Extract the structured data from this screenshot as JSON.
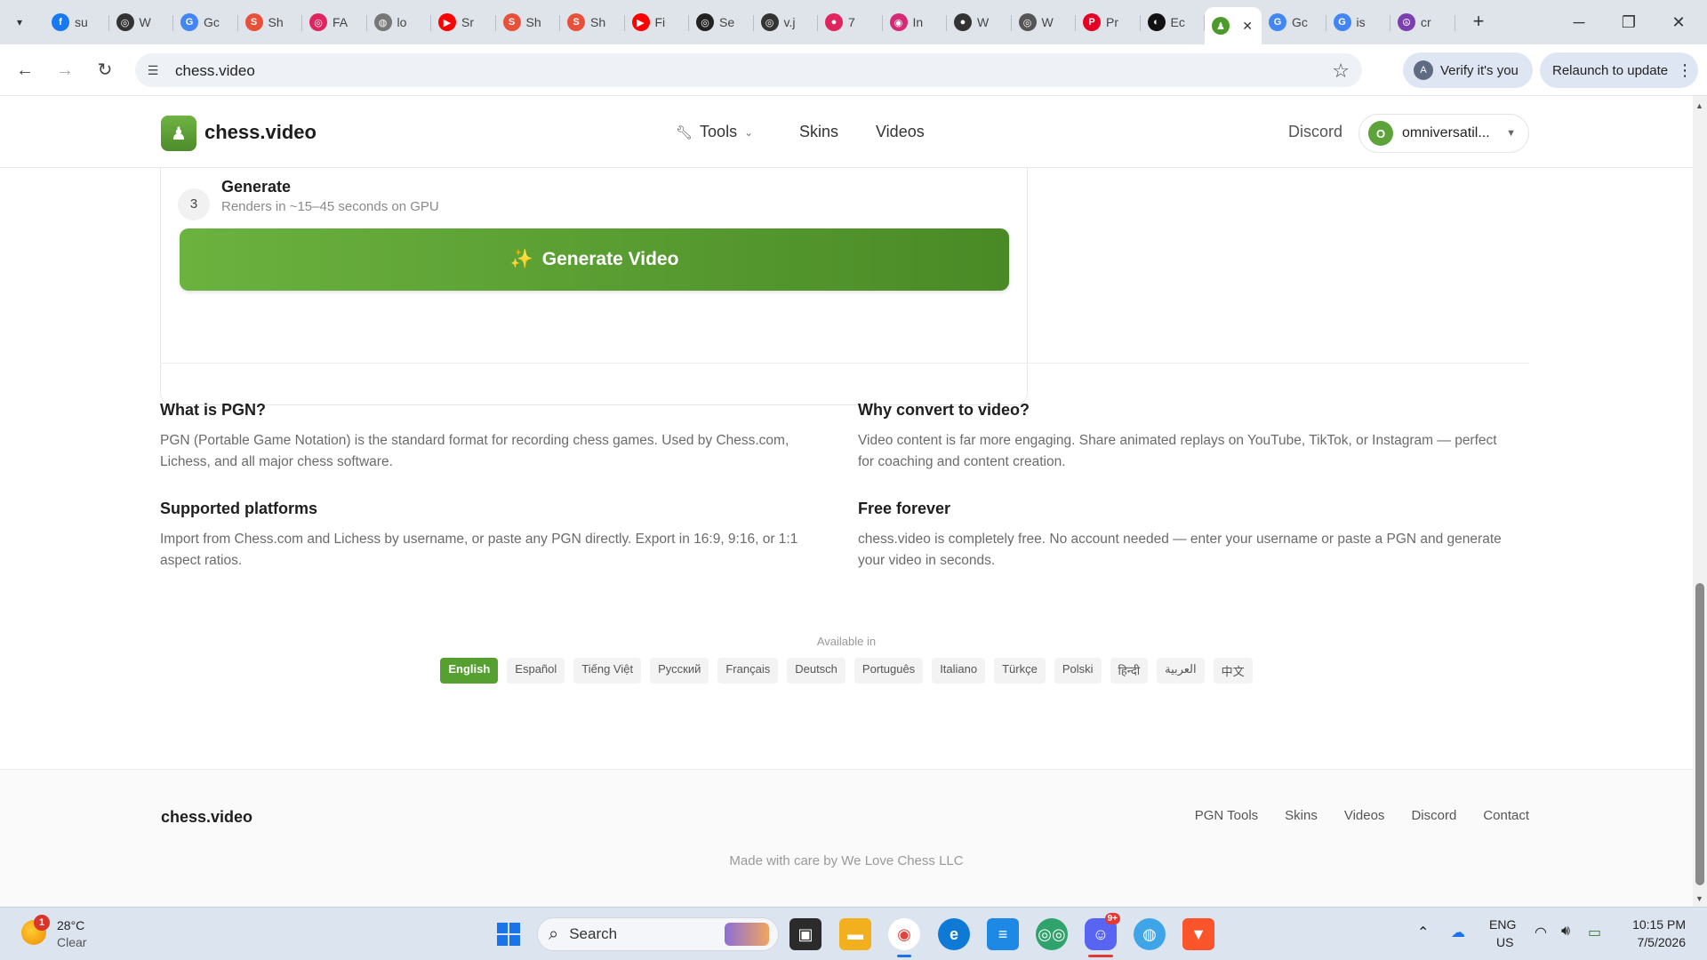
{
  "browser": {
    "tabs": [
      {
        "label": "su",
        "icon": "facebook-icon",
        "color": "#1877f2",
        "glyph": "f"
      },
      {
        "label": "W",
        "icon": "openai-icon",
        "color": "#333333",
        "glyph": "◎"
      },
      {
        "label": "Gc",
        "icon": "google-icon",
        "color": "#4285f4",
        "glyph": "G"
      },
      {
        "label": "Sh",
        "icon": "shopify-icon",
        "color": "#e8503a",
        "glyph": "S"
      },
      {
        "label": "FA",
        "icon": "target-icon",
        "color": "#e0245e",
        "glyph": "◎"
      },
      {
        "label": "lo",
        "icon": "globe-icon",
        "color": "#777777",
        "glyph": "◍"
      },
      {
        "label": "Sr",
        "icon": "youtube-icon",
        "color": "#ff0000",
        "glyph": "▶"
      },
      {
        "label": "Sh",
        "icon": "shopify-icon",
        "color": "#e8503a",
        "glyph": "S"
      },
      {
        "label": "Sh",
        "icon": "shopify-icon",
        "color": "#e8503a",
        "glyph": "S"
      },
      {
        "label": "Fi",
        "icon": "youtube-icon",
        "color": "#ff0000",
        "glyph": "▶"
      },
      {
        "label": "Se",
        "icon": "openai-icon",
        "color": "#222222",
        "glyph": "◎"
      },
      {
        "label": "v.j",
        "icon": "openai-icon",
        "color": "#333333",
        "glyph": "◎"
      },
      {
        "label": "7",
        "icon": "record-icon",
        "color": "#e0245e",
        "glyph": "●"
      },
      {
        "label": "In",
        "icon": "instagram-icon",
        "color": "#d62976",
        "glyph": "◉"
      },
      {
        "label": "W",
        "icon": "movie-icon",
        "color": "#333333",
        "glyph": "●"
      },
      {
        "label": "W",
        "icon": "openai-icon",
        "color": "#555555",
        "glyph": "◎"
      },
      {
        "label": "Pr",
        "icon": "pinterest-icon",
        "color": "#e60023",
        "glyph": "P"
      },
      {
        "label": "Ec",
        "icon": "github-icon",
        "color": "#111111",
        "glyph": "◐"
      },
      {
        "label": "",
        "icon": "chess-video-icon",
        "color": "#4c9a2a",
        "glyph": "♟",
        "active": true
      },
      {
        "label": "Gc",
        "icon": "google-icon",
        "color": "#4285f4",
        "glyph": "G"
      },
      {
        "label": "is",
        "icon": "google-icon",
        "color": "#4285f4",
        "glyph": "G"
      },
      {
        "label": "cr",
        "icon": "peace-icon",
        "color": "#7b3fb0",
        "glyph": "☮"
      }
    ],
    "url": "chess.video",
    "verify_label": "Verify it's you",
    "verify_avatar": "A",
    "relaunch_label": "Relaunch to update"
  },
  "site": {
    "logo_text": "chess.video",
    "nav": {
      "tools": "Tools",
      "skins": "Skins",
      "videos": "Videos",
      "discord": "Discord"
    },
    "user": {
      "initial": "O",
      "name": "omniversatil..."
    }
  },
  "generate": {
    "step_number": "3",
    "step_title": "Generate",
    "step_subtitle": "Renders in ~15–45 seconds on GPU",
    "button_label": "Generate Video",
    "button_emoji": "✨"
  },
  "info": {
    "pgn_title": "What is PGN?",
    "pgn_text": "PGN (Portable Game Notation) is the standard format for recording chess games. Used by Chess.com, Lichess, and all major chess software.",
    "why_title": "Why convert to video?",
    "why_text": "Video content is far more engaging. Share animated replays on YouTube, TikTok, or Instagram — perfect for coaching and content creation.",
    "platforms_title": "Supported platforms",
    "platforms_text": "Import from Chess.com and Lichess by username, or paste any PGN directly. Export in 16:9, 9:16, or 1:1 aspect ratios.",
    "free_title": "Free forever",
    "free_text": "chess.video is completely free. No account needed — enter your username or paste a PGN and generate your video in seconds."
  },
  "languages": {
    "label": "Available in",
    "items": [
      "English",
      "Español",
      "Tiếng Việt",
      "Русский",
      "Français",
      "Deutsch",
      "Português",
      "Italiano",
      "Türkçe",
      "Polski",
      "हिन्दी",
      "العربية",
      "中文"
    ],
    "selected": "English"
  },
  "footer": {
    "brand": "chess.video",
    "links": [
      "PGN Tools",
      "Skins",
      "Videos",
      "Discord",
      "Contact"
    ],
    "credit": "Made with care by We Love Chess LLC"
  },
  "taskbar": {
    "weather_temp": "28°C",
    "weather_cond": "Clear",
    "weather_badge": "1",
    "search_label": "Search",
    "lang_top": "ENG",
    "lang_bottom": "US",
    "time": "10:15 PM",
    "date": "7/5/2026",
    "discord_badge": "9+"
  },
  "colors": {
    "brand_green": "#56a031",
    "button_green_start": "#6bb23f",
    "button_green_end": "#4a8a26"
  }
}
